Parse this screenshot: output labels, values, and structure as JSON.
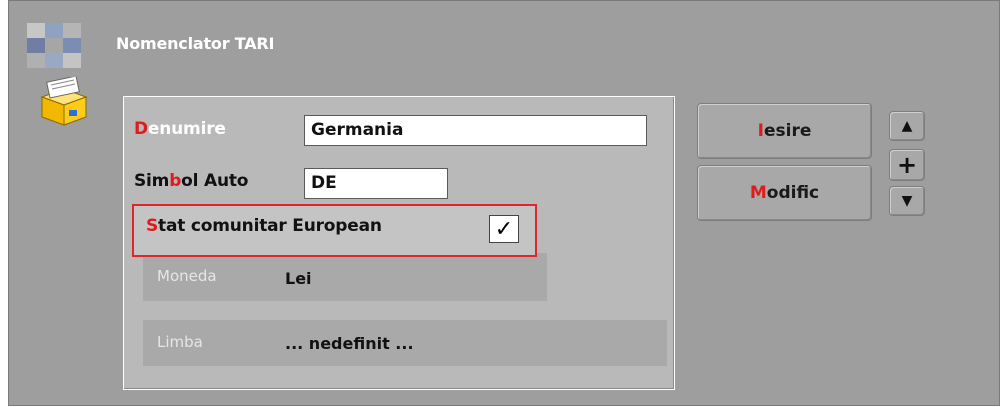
{
  "window": {
    "title": "Nomenclator TARI"
  },
  "form": {
    "denumire": {
      "hotkey": "D",
      "rest": "enumire",
      "value": "Germania"
    },
    "simbol_auto": {
      "pre": "Sim",
      "hotkey": "b",
      "rest": "ol Auto",
      "value": "DE"
    },
    "stat_comunitar": {
      "hotkey": "S",
      "rest": "tat comunitar European",
      "checked_glyph": "✓"
    },
    "moneda": {
      "label": "Moneda",
      "value": "Lei"
    },
    "limba": {
      "label": "Limba",
      "value": "... nedefinit ..."
    }
  },
  "buttons": {
    "iesire": {
      "hotkey": "I",
      "rest": "esire"
    },
    "modific": {
      "hotkey": "M",
      "rest": "odific"
    }
  },
  "nav": {
    "up_glyph": "▲",
    "add_glyph": "+",
    "down_glyph": "▼"
  },
  "colors": {
    "accent_red": "#e01b1b",
    "panel_bg": "#b9b9b9",
    "frame_bg": "#9e9e9e"
  }
}
